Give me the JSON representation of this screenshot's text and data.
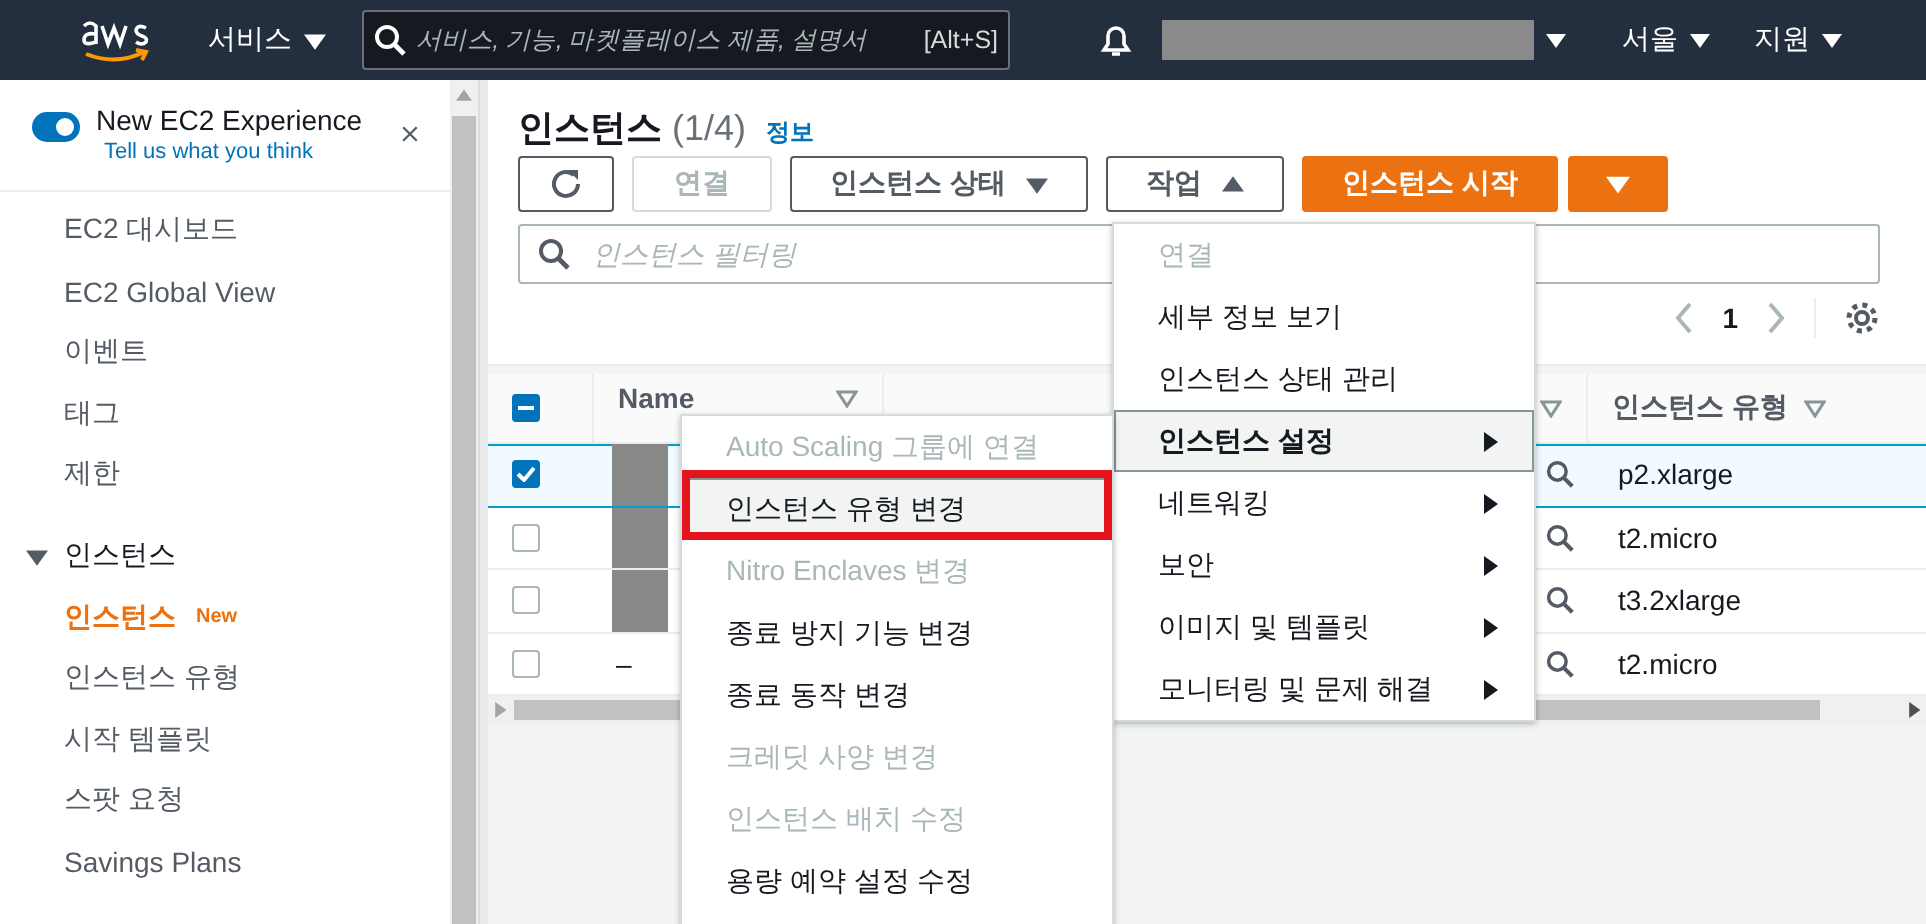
{
  "top_nav": {
    "services": "서비스",
    "search_placeholder": "서비스, 기능, 마켓플레이스 제품, 설명서",
    "search_shortcut": "[Alt+S]",
    "account_redacted": true,
    "region": "서울",
    "support": "지원"
  },
  "sidebar": {
    "experience": {
      "label": "New EC2 Experience",
      "on": true,
      "feedback_link": "Tell us what you think"
    },
    "items": [
      {
        "label": "EC2 대시보드"
      },
      {
        "label": "EC2 Global View"
      },
      {
        "label": "이벤트"
      },
      {
        "label": "태그"
      },
      {
        "label": "제한"
      }
    ],
    "section": {
      "title": "인스턴스",
      "expanded": true,
      "items": [
        {
          "label": "인스턴스",
          "selected": true,
          "badge": "New"
        },
        {
          "label": "인스턴스 유형",
          "selected": false
        },
        {
          "label": "시작 템플릿",
          "selected": false
        },
        {
          "label": "스팟 요청",
          "selected": false
        },
        {
          "label": "Savings Plans",
          "selected": false
        }
      ]
    }
  },
  "header": {
    "title": "인스턴스",
    "count": "(1/4)",
    "info_link": "정보"
  },
  "toolbar": {
    "connect": {
      "label": "연결",
      "disabled": true
    },
    "instance_state": "인스턴스 상태",
    "actions": {
      "label": "작업",
      "expanded": true
    },
    "launch": "인스턴스 시작"
  },
  "filter": {
    "placeholder": "인스턴스 필터링"
  },
  "pagination": {
    "page": "1"
  },
  "table": {
    "header_checkbox": {
      "indeterminate": true
    },
    "columns": [
      {
        "label": "Name"
      },
      {
        "label": "인스턴스 유형"
      }
    ],
    "rows": [
      {
        "selected": true,
        "redacted": true,
        "type": "p2.xlarge"
      },
      {
        "selected": false,
        "redacted": true,
        "type": "t2.micro"
      },
      {
        "selected": false,
        "redacted": true,
        "type": "t3.2xlarge"
      },
      {
        "selected": false,
        "redacted": false,
        "name": "–",
        "type": "t2.micro"
      }
    ]
  },
  "actions_menu": {
    "items": [
      {
        "label": "연결",
        "disabled": true,
        "selected": false,
        "submenu": false
      },
      {
        "label": "세부 정보 보기",
        "disabled": false,
        "selected": false,
        "submenu": false
      },
      {
        "label": "인스턴스 상태 관리",
        "disabled": false,
        "selected": false,
        "submenu": false
      },
      {
        "label": "인스턴스 설정",
        "disabled": false,
        "selected": true,
        "submenu": true
      },
      {
        "label": "네트워킹",
        "disabled": false,
        "selected": false,
        "submenu": true
      },
      {
        "label": "보안",
        "disabled": false,
        "selected": false,
        "submenu": true
      },
      {
        "label": "이미지 및 템플릿",
        "disabled": false,
        "selected": false,
        "submenu": true
      },
      {
        "label": "모니터링 및 문제 해결",
        "disabled": false,
        "selected": false,
        "submenu": true
      }
    ]
  },
  "settings_submenu": {
    "items": [
      {
        "label": "Auto Scaling 그룹에 연결",
        "disabled": true,
        "selected": false,
        "annotated": false
      },
      {
        "label": "인스턴스 유형 변경",
        "disabled": false,
        "selected": true,
        "annotated": true
      },
      {
        "label": "Nitro Enclaves 변경",
        "disabled": true,
        "selected": false,
        "annotated": false
      },
      {
        "label": "종료 방지 기능 변경",
        "disabled": false,
        "selected": false,
        "annotated": false
      },
      {
        "label": "종료 동작 변경",
        "disabled": false,
        "selected": false,
        "annotated": false
      },
      {
        "label": "크레딧 사양 변경",
        "disabled": true,
        "selected": false,
        "annotated": false
      },
      {
        "label": "인스턴스 배치 수정",
        "disabled": true,
        "selected": false,
        "annotated": false
      },
      {
        "label": "용량 예약 설정 수정",
        "disabled": false,
        "selected": false,
        "annotated": false
      }
    ]
  }
}
